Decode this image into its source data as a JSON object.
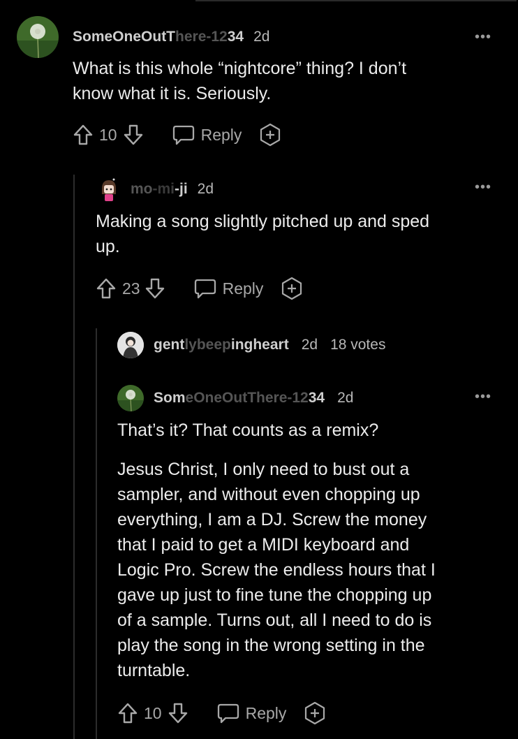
{
  "comments": [
    {
      "username_visible": "SomeOneOutT",
      "username_faded": "here-12",
      "username_tail": "34",
      "age": "2d",
      "body": [
        "What is this whole “nightcore” thing? I don’t",
        "know what it is. Seriously."
      ],
      "votes": "10",
      "reply_label": "Reply"
    },
    {
      "username_visible": "mo",
      "username_faded": "-mi",
      "username_tail": "-ji",
      "age": "2d",
      "body": [
        "Making a song slightly pitched up and sped",
        "up."
      ],
      "votes": "23",
      "reply_label": "Reply"
    },
    {
      "username_visible": "gent",
      "username_faded": "lybeep",
      "username_tail": "ingheart",
      "age": "2d",
      "extra": "18 votes"
    },
    {
      "username_visible": "Som",
      "username_faded": "eOneOutThere-12",
      "username_tail": "34",
      "age": "2d",
      "body_first": "That’s it? That counts as a remix?",
      "body": [
        "Jesus Christ, I only need to bust out a",
        "sampler, and without even chopping up",
        "everything, I am a DJ. Screw the money",
        "that I paid to get a MIDI keyboard and",
        "Logic Pro. Screw the endless hours that I",
        "gave up just to fine tune the chopping up",
        "of a sample. Turns out, all I need to do is",
        "play the song in the wrong setting in the",
        "turntable."
      ],
      "votes": "10",
      "reply_label": "Reply"
    }
  ],
  "more_label": "•••",
  "icons": [
    "dandelion-avatar",
    "anime-avatar",
    "user-photo-avatar",
    "upvote-icon",
    "downvote-icon",
    "reply-bubble-icon",
    "award-icon",
    "more-icon"
  ]
}
